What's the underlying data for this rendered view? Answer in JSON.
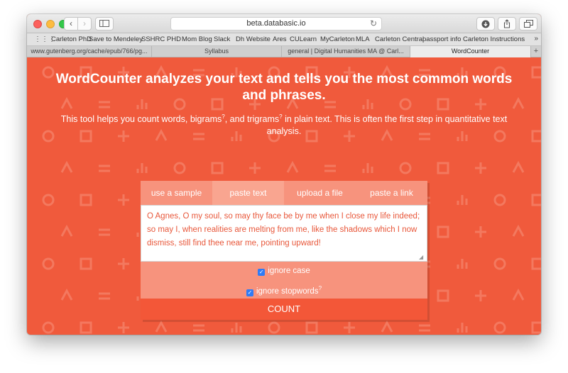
{
  "browser": {
    "url": "beta.databasic.io",
    "bookmarks": [
      "Carleton PhD",
      "Save to Mendeley",
      "SSHRC PHD",
      "Mom Blog",
      "Slack",
      "Dh Website",
      "Ares",
      "CULearn",
      "MyCarleton",
      "MLA",
      "Carleton Central",
      "passport info",
      "Carleton Instructions"
    ],
    "tabs": [
      {
        "label": "www.gutenberg.org/cache/epub/766/pg...",
        "active": false
      },
      {
        "label": "Syllabus",
        "active": false
      },
      {
        "label": "general | Digital Humanities MA @ Carl...",
        "active": false
      },
      {
        "label": "WordCounter",
        "active": true
      }
    ]
  },
  "page": {
    "headline": "WordCounter analyzes your text and tells you the most common words and phrases.",
    "sub_part1": "This tool helps you count words, bigrams",
    "sub_part2": ", and trigrams",
    "sub_part3": " in plain text. This is often the first step in quantitative text analysis.",
    "help_mark": "?"
  },
  "widget": {
    "tabs": [
      {
        "label": "use a sample",
        "active": false
      },
      {
        "label": "paste text",
        "active": true
      },
      {
        "label": "upload a file",
        "active": false
      },
      {
        "label": "paste a link",
        "active": false
      }
    ],
    "text": "O Agnes, O my soul, so may thy face be by me when I close my life indeed; so may I, when realities are melting from me, like the shadows which I now dismiss, still find thee near me, pointing upward!",
    "ignore_case_label": "ignore case",
    "ignore_case_checked": true,
    "ignore_stopwords_label": "ignore stopwords",
    "ignore_stopwords_checked": true,
    "count_label": "COUNT"
  },
  "colors": {
    "background": "#f05a3c",
    "tab_bar": "#f7937d",
    "active_tab": "#f9a590",
    "count_button": "#f35738",
    "text_color": "#e8573a",
    "checkbox": "#2f7bf5"
  }
}
